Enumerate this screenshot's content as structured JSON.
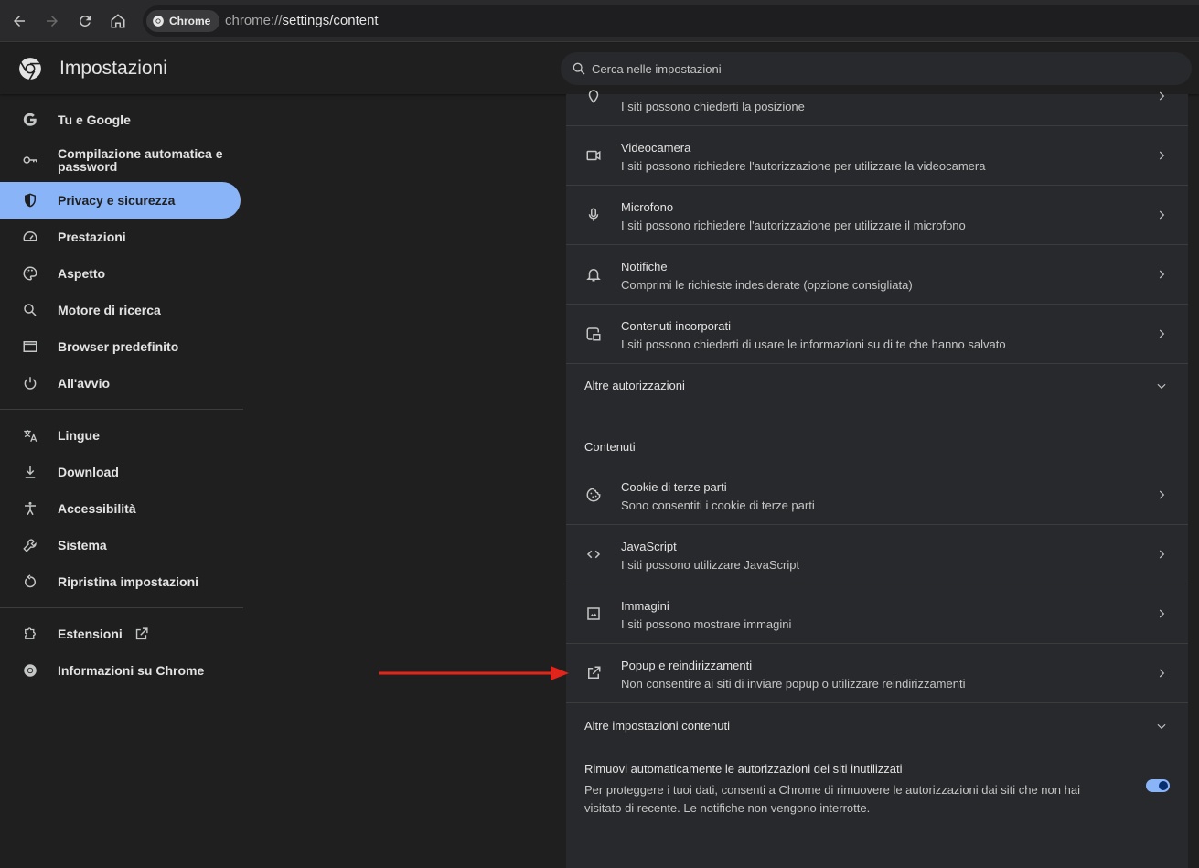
{
  "browser": {
    "chip_label": "Chrome",
    "url_scheme": "chrome://",
    "url_path": "settings/content"
  },
  "header": {
    "title": "Impostazioni",
    "search_placeholder": "Cerca nelle impostazioni"
  },
  "sidebar": {
    "items": [
      {
        "label": "Tu e Google",
        "icon": "google-icon"
      },
      {
        "label": "Compilazione automatica e password",
        "icon": "key-icon"
      },
      {
        "label": "Privacy e sicurezza",
        "icon": "shield-icon",
        "active": true
      },
      {
        "label": "Prestazioni",
        "icon": "speedometer-icon"
      },
      {
        "label": "Aspetto",
        "icon": "palette-icon"
      },
      {
        "label": "Motore di ricerca",
        "icon": "search-icon"
      },
      {
        "label": "Browser predefinito",
        "icon": "browser-window-icon"
      },
      {
        "label": "All'avvio",
        "icon": "power-icon"
      },
      {
        "label": "Lingue",
        "icon": "translate-icon"
      },
      {
        "label": "Download",
        "icon": "download-icon"
      },
      {
        "label": "Accessibilità",
        "icon": "accessibility-icon"
      },
      {
        "label": "Sistema",
        "icon": "wrench-icon"
      },
      {
        "label": "Ripristina impostazioni",
        "icon": "reset-icon"
      },
      {
        "label": "Estensioni",
        "icon": "puzzle-icon"
      },
      {
        "label": "Informazioni su Chrome",
        "icon": "chrome-icon"
      }
    ]
  },
  "main": {
    "permission_rows": [
      {
        "title": "",
        "subtitle": "I siti possono chiederti la posizione",
        "icon": "location-icon"
      },
      {
        "title": "Videocamera",
        "subtitle": "I siti possono richiedere l'autorizzazione per utilizzare la videocamera",
        "icon": "camera-icon"
      },
      {
        "title": "Microfono",
        "subtitle": "I siti possono richiedere l'autorizzazione per utilizzare il microfono",
        "icon": "microphone-icon"
      },
      {
        "title": "Notifiche",
        "subtitle": "Comprimi le richieste indesiderate (opzione consigliata)",
        "icon": "bell-icon"
      },
      {
        "title": "Contenuti incorporati",
        "subtitle": "I siti possono chiederti di usare le informazioni su di te che hanno salvato",
        "icon": "embedded-content-icon"
      }
    ],
    "more_permissions": "Altre autorizzazioni",
    "content_heading": "Contenuti",
    "content_rows": [
      {
        "title": "Cookie di terze parti",
        "subtitle": "Sono consentiti i cookie di terze parti",
        "icon": "cookie-icon"
      },
      {
        "title": "JavaScript",
        "subtitle": "I siti possono utilizzare JavaScript",
        "icon": "code-icon"
      },
      {
        "title": "Immagini",
        "subtitle": "I siti possono mostrare immagini",
        "icon": "image-icon"
      },
      {
        "title": "Popup e reindirizzamenti",
        "subtitle": "Non consentire ai siti di inviare popup o utilizzare reindirizzamenti",
        "icon": "open-external-icon"
      }
    ],
    "more_content": "Altre impostazioni contenuti",
    "auto_remove": {
      "title": "Rimuovi automaticamente le autorizzazioni dei siti inutilizzati",
      "description": "Per proteggere i tuoi dati, consenti a Chrome di rimuovere le autorizzazioni dai siti che non hai visitato di recente. Le notifiche non vengono interrotte.",
      "enabled": true
    }
  },
  "colors": {
    "accent": "#8ab4f8",
    "annotation_arrow": "#e3241b"
  }
}
